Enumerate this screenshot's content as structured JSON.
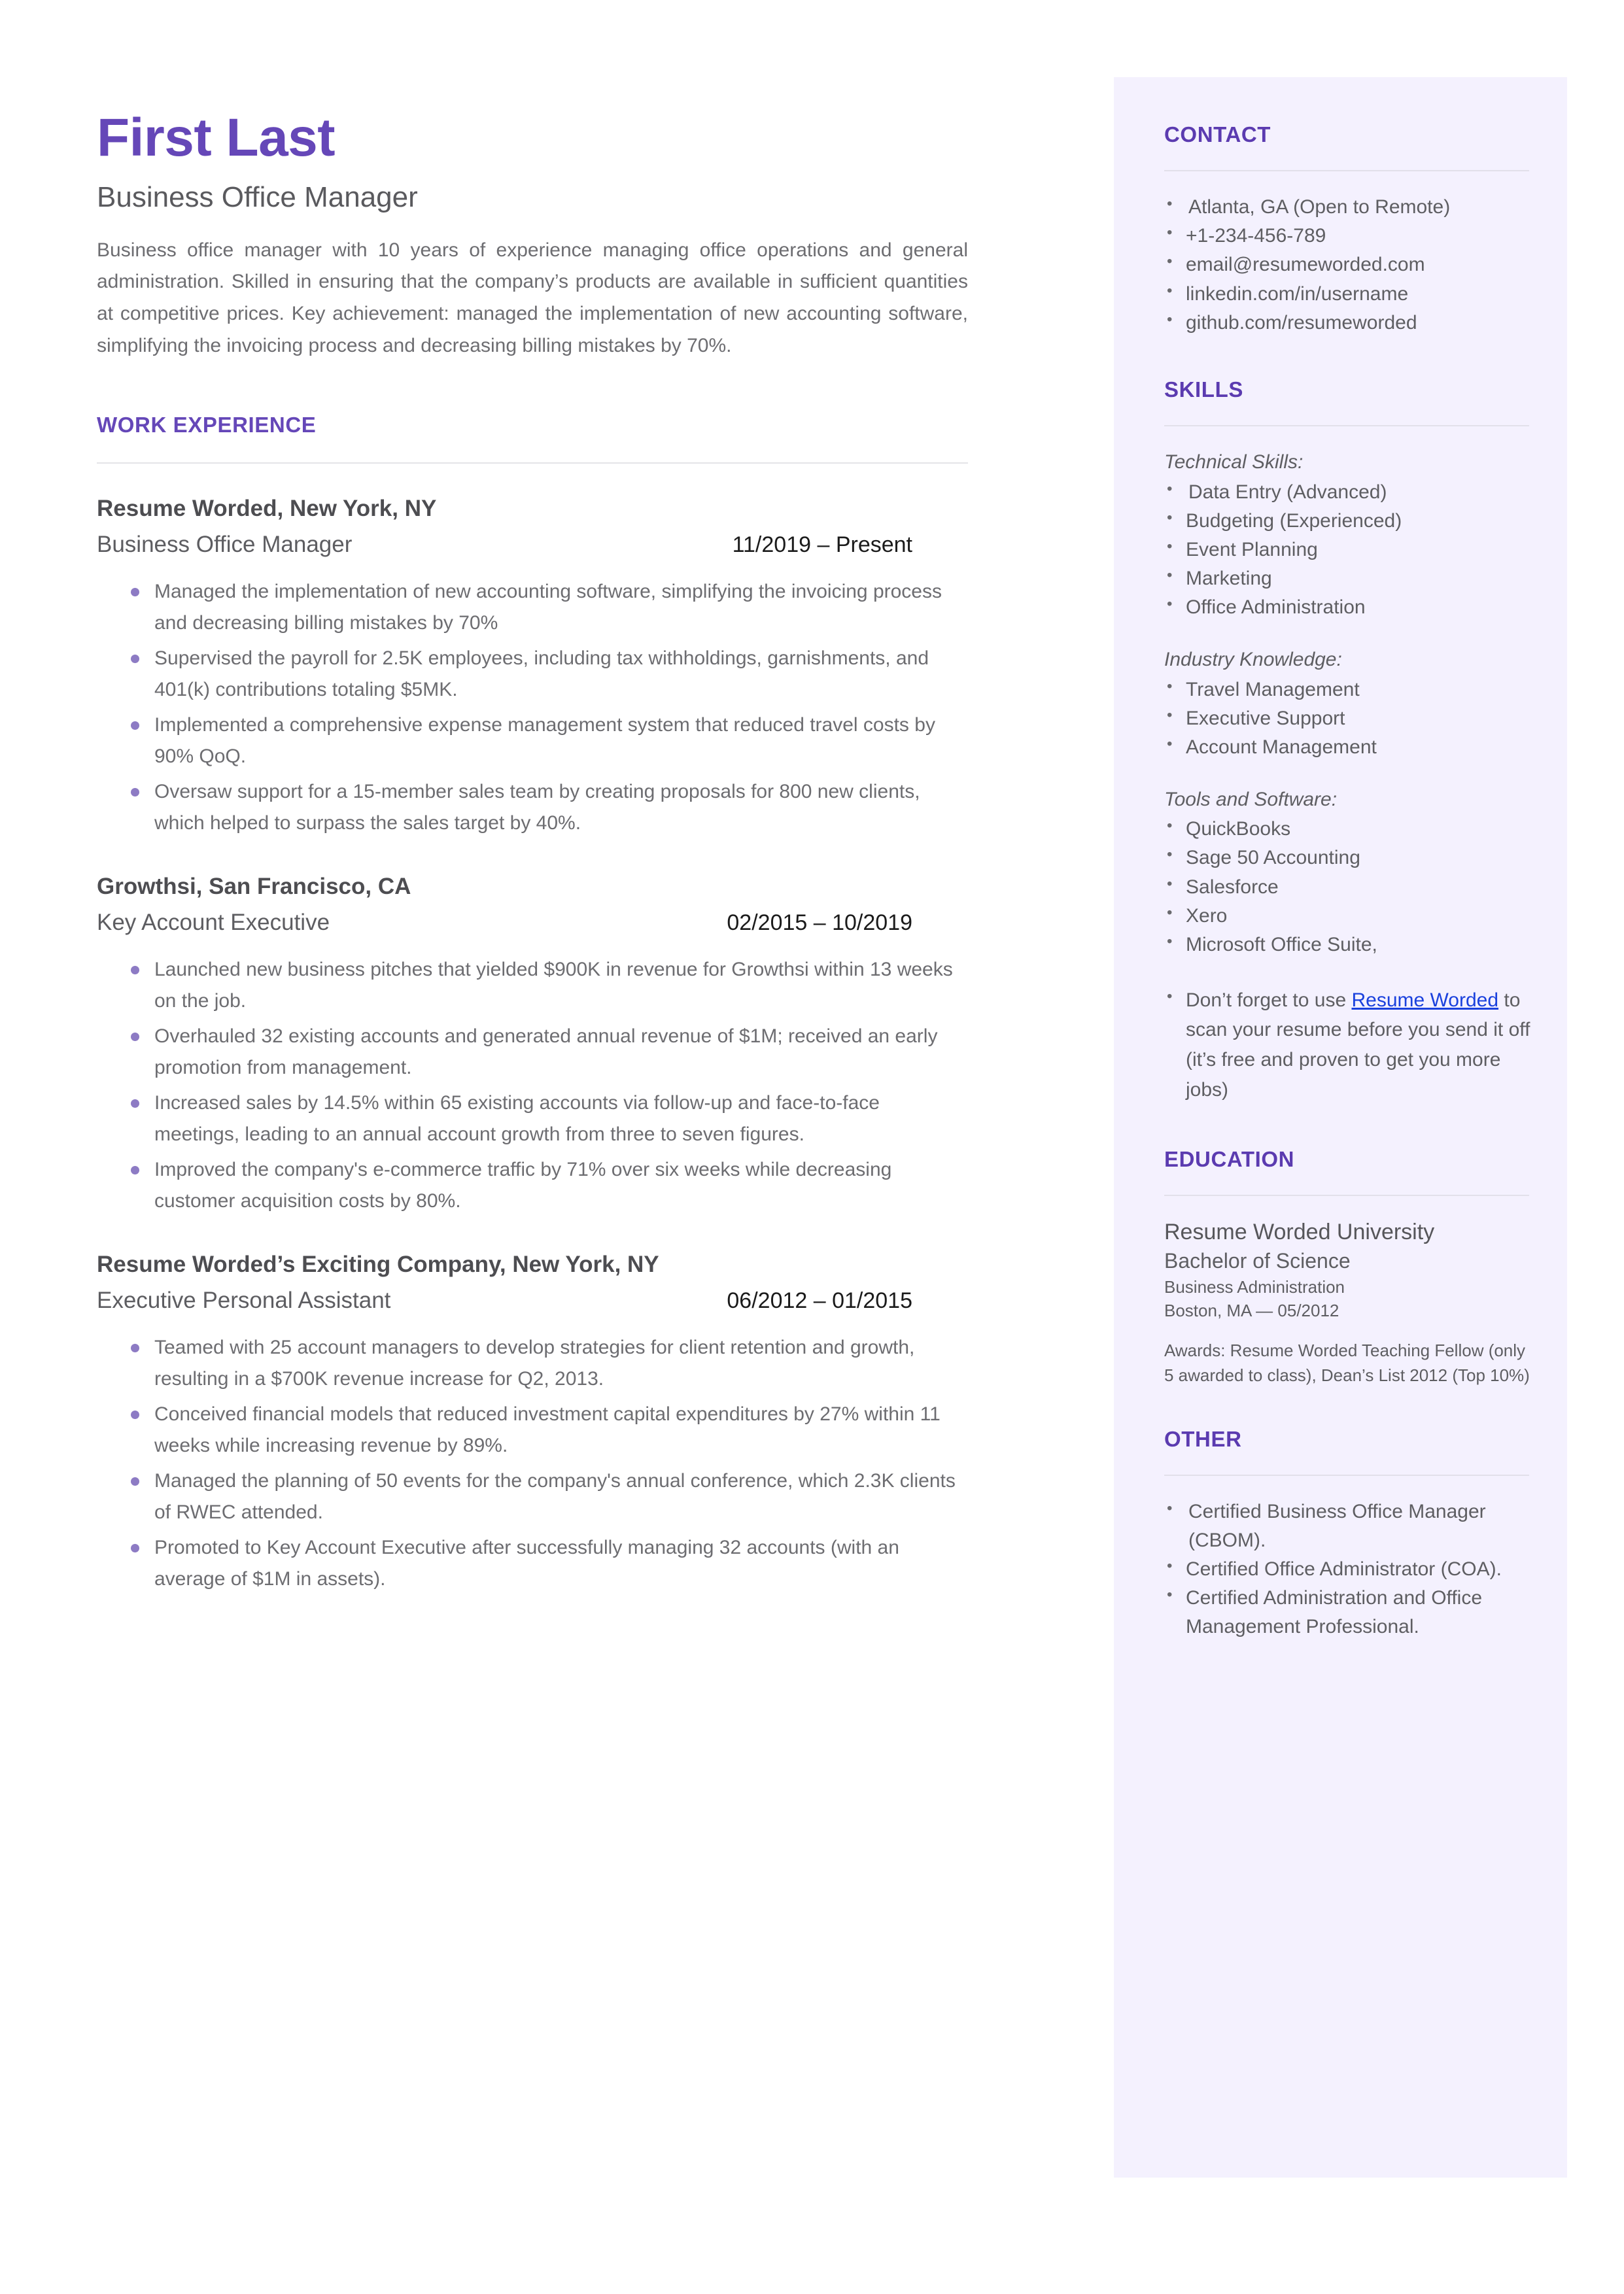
{
  "colors": {
    "accent_purple": "#6547b8",
    "sidebar_bg": "#f4f1fe",
    "body_text": "#6d6d71",
    "link_blue": "#1a41dd",
    "bullet_purple": "#8d7bc4"
  },
  "header": {
    "name": "First Last",
    "headline": "Business Office Manager",
    "summary": "Business office manager with 10 years of experience managing office operations and general administration. Skilled in ensuring that the company’s products are available in sufficient quantities at competitive prices. Key achievement: managed the implementation of new accounting software, simplifying the invoicing process and decreasing billing mistakes by 70%."
  },
  "work_experience": {
    "heading": "WORK EXPERIENCE",
    "jobs": [
      {
        "company": "Resume Worded, New York, NY",
        "title": "Business Office Manager",
        "dates": "11/2019 – Present",
        "bullets": [
          "Managed the implementation of new accounting software, simplifying the invoicing process and decreasing billing mistakes by 70%",
          "Supervised the payroll for 2.5K employees, including tax withholdings, garnishments, and 401(k) contributions totaling $5MK.",
          "Implemented a comprehensive expense management system that reduced travel costs by 90% QoQ.",
          "Oversaw support for a 15-member sales team by creating proposals for 800 new clients, which helped to surpass the sales target by 40%."
        ]
      },
      {
        "company": "Growthsi, San Francisco, CA",
        "title": "Key Account Executive",
        "dates": "02/2015 – 10/2019",
        "bullets": [
          "Launched new business pitches that yielded $900K in revenue for Growthsi within 13 weeks on the job.",
          "Overhauled 32 existing accounts and generated annual revenue of $1M; received an early promotion from management.",
          "Increased sales by 14.5% within 65 existing accounts via follow-up and face-to-face meetings, leading to an annual account growth from three to seven figures.",
          "Improved the company's e-commerce traffic by 71% over six weeks while decreasing customer acquisition costs by 80%."
        ]
      },
      {
        "company": "Resume Worded’s Exciting Company, New York, NY",
        "title": "Executive Personal Assistant",
        "dates": "06/2012 – 01/2015",
        "bullets": [
          "Teamed with 25 account managers to develop strategies for client retention and growth, resulting in a $700K revenue increase for Q2, 2013.",
          "Conceived financial models that reduced investment capital expenditures by 27% within 11 weeks while increasing revenue by 89%.",
          "Managed the planning of 50 events for the company's annual conference, which 2.3K clients of RWEC attended.",
          "Promoted to Key Account Executive after successfully managing  32 accounts (with an average of $1M in assets)."
        ]
      }
    ]
  },
  "contact": {
    "heading": "CONTACT",
    "items": [
      "Atlanta, GA (Open to Remote)",
      "+1-234-456-789",
      "email@resumeworded.com",
      "linkedin.com/in/username",
      "github.com/resumeworded"
    ]
  },
  "skills": {
    "heading": "SKILLS",
    "groups": [
      {
        "label": "Technical Skills:",
        "items": [
          "Data Entry (Advanced)",
          "Budgeting (Experienced)",
          "Event Planning",
          "Marketing",
          "Office Administration"
        ]
      },
      {
        "label": "Industry Knowledge:",
        "items": [
          "Travel Management",
          "Executive Support",
          "Account Management"
        ]
      },
      {
        "label": "Tools and Software:",
        "items": [
          "QuickBooks",
          "Sage 50 Accounting",
          "Salesforce",
          "Xero",
          "Microsoft Office Suite,"
        ]
      }
    ],
    "promo": {
      "before": "Don’t forget to use ",
      "link": "Resume Worded",
      "after": " to scan your resume before you send it off (it’s free and proven to get you more jobs)"
    }
  },
  "education": {
    "heading": "EDUCATION",
    "school": "Resume Worded University",
    "degree": "Bachelor of Science",
    "field": "Business Administration",
    "location_date": "Boston, MA — 05/2012",
    "awards": "Awards: Resume Worded Teaching Fellow (only 5 awarded to class), Dean’s List 2012 (Top 10%)"
  },
  "other": {
    "heading": "OTHER",
    "items": [
      "Certified Business Office Manager (CBOM).",
      "Certified Office Administrator (COA).",
      "Certified Administration and Office Management Professional."
    ]
  }
}
